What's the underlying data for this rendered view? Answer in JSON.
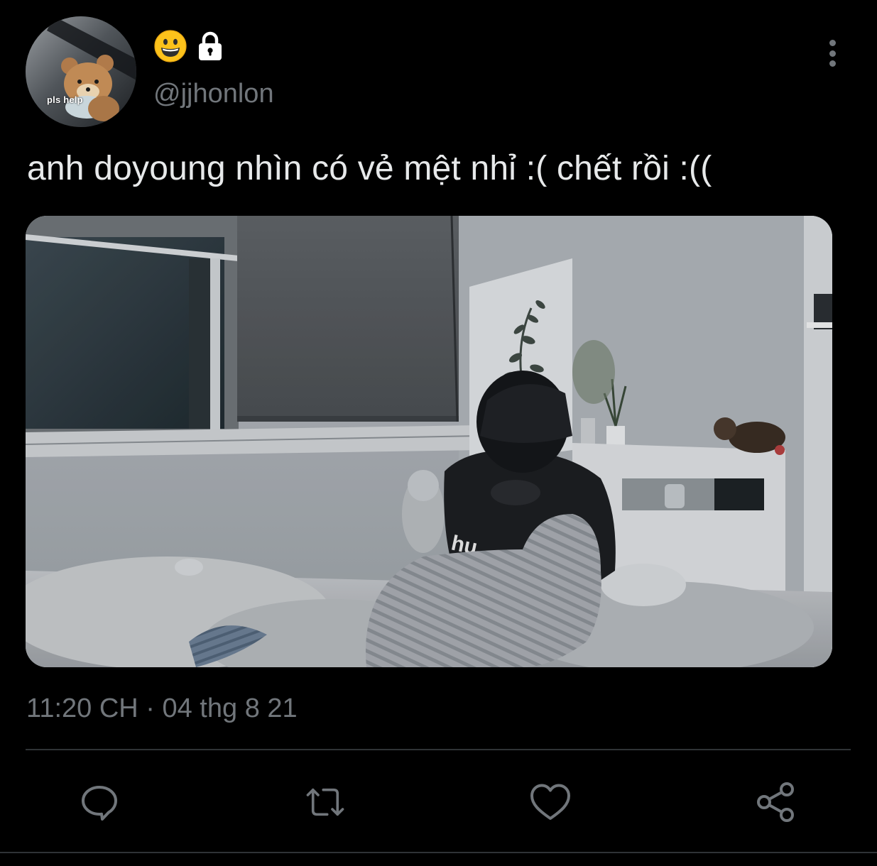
{
  "user": {
    "avatar_caption": "pls help",
    "emoji": "😀",
    "handle": "@jjhonlon",
    "protected": true
  },
  "tweet": {
    "text": "anh doyoung nhìn có vẻ mệt nhỉ :( chết rồi :((",
    "timestamp": "11:20 CH · 04 thg 8 21",
    "media_sweater_text": "hu"
  },
  "actions": [
    {
      "name": "reply",
      "icon": "reply-icon"
    },
    {
      "name": "retweet",
      "icon": "retweet-icon"
    },
    {
      "name": "like",
      "icon": "heart-icon"
    },
    {
      "name": "share",
      "icon": "share-icon"
    }
  ],
  "colors": {
    "background": "#000000",
    "text_primary": "#e7e9ea",
    "text_secondary": "#71767b",
    "divider": "#2f3336"
  }
}
